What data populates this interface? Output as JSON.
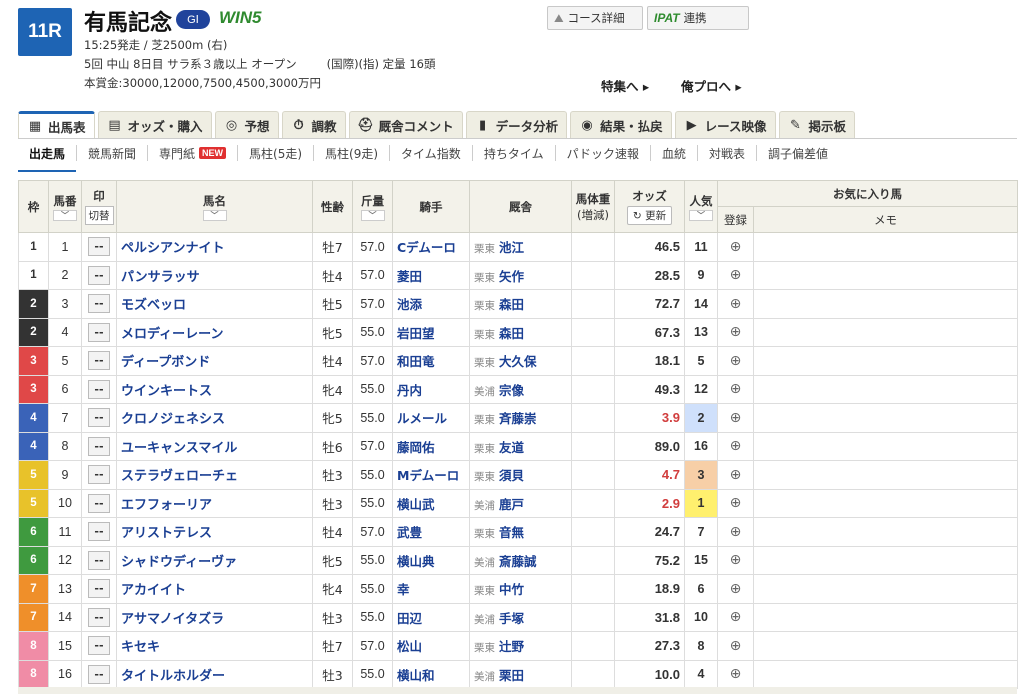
{
  "race": {
    "number": "11R",
    "title": "有馬記念",
    "grade": "GⅠ",
    "win5": "WIN5",
    "time_course": "15:25発走 / 芝2500m (右)",
    "meeting": "5回 中山 8日目 サラ系３歳以上 オープン",
    "conditions": "(国際)(指) 定量 16頭",
    "prize": "本賞金:30000,12000,7500,4500,3000万円"
  },
  "buttons": {
    "course": "コース詳細",
    "ipat_logo": "IPAT",
    "ipat": "連携"
  },
  "links": {
    "special": "特集へ ▸",
    "pro": "俺プロへ ▸"
  },
  "tabs": [
    {
      "label": "出馬表",
      "icon": "table-icon",
      "glyph": "▦"
    },
    {
      "label": "オッズ・購入",
      "icon": "calculator-icon",
      "glyph": "▤"
    },
    {
      "label": "予想",
      "icon": "target-icon",
      "glyph": "◎"
    },
    {
      "label": "調教",
      "icon": "stopwatch-icon",
      "glyph": "⏱"
    },
    {
      "label": "厩舎コメント",
      "icon": "helmet-icon",
      "glyph": "⛑"
    },
    {
      "label": "データ分析",
      "icon": "bar-chart-icon",
      "glyph": "▮"
    },
    {
      "label": "結果・払戻",
      "icon": "coins-icon",
      "glyph": "◉"
    },
    {
      "label": "レース映像",
      "icon": "video-icon",
      "glyph": "▶"
    },
    {
      "label": "掲示板",
      "icon": "chat-icon",
      "glyph": "✎"
    }
  ],
  "subtabs": {
    "t0": "出走馬",
    "t1": "競馬新聞",
    "t2": "専門紙",
    "new": "NEW",
    "t3": "馬柱(5走)",
    "t4": "馬柱(9走)",
    "t5": "タイム指数",
    "t6": "持ちタイム",
    "t7": "パドック速報",
    "t8": "血統",
    "t9": "対戦表",
    "t10": "調子偏差値"
  },
  "headers": {
    "waku": "枠",
    "umaban": "馬番",
    "mark": "印",
    "kirikae": "切替",
    "name": "馬名",
    "sexage": "性齢",
    "weight": "斤量",
    "jockey": "騎手",
    "stable": "厩舎",
    "bodyweight": "馬体重",
    "bodyweight2": "(増減)",
    "odds": "オッズ",
    "refresh": "更新",
    "pop": "人気",
    "fav": "お気に入り馬",
    "register": "登録",
    "memo": "メモ",
    "sort": "﹀"
  },
  "horses": [
    {
      "waku": "1",
      "num": "1",
      "mark": "--",
      "name": "ペルシアンナイト",
      "sexage": "牡7",
      "weight": "57.0",
      "jockey": "Cデムーロ",
      "stable": "栗東",
      "trainer": "池江",
      "odds": "46.5",
      "pop": "11"
    },
    {
      "waku": "1",
      "num": "2",
      "mark": "--",
      "name": "パンサラッサ",
      "sexage": "牡4",
      "weight": "57.0",
      "jockey": "菱田",
      "stable": "栗東",
      "trainer": "矢作",
      "odds": "28.5",
      "pop": "9"
    },
    {
      "waku": "2",
      "num": "3",
      "mark": "--",
      "name": "モズベッロ",
      "sexage": "牡5",
      "weight": "57.0",
      "jockey": "池添",
      "stable": "栗東",
      "trainer": "森田",
      "odds": "72.7",
      "pop": "14"
    },
    {
      "waku": "2",
      "num": "4",
      "mark": "--",
      "name": "メロディーレーン",
      "sexage": "牝5",
      "weight": "55.0",
      "jockey": "岩田望",
      "stable": "栗東",
      "trainer": "森田",
      "odds": "67.3",
      "pop": "13"
    },
    {
      "waku": "3",
      "num": "5",
      "mark": "--",
      "name": "ディープボンド",
      "sexage": "牡4",
      "weight": "57.0",
      "jockey": "和田竜",
      "stable": "栗東",
      "trainer": "大久保",
      "odds": "18.1",
      "pop": "5"
    },
    {
      "waku": "3",
      "num": "6",
      "mark": "--",
      "name": "ウインキートス",
      "sexage": "牝4",
      "weight": "55.0",
      "jockey": "丹内",
      "stable": "美浦",
      "trainer": "宗像",
      "odds": "49.3",
      "pop": "12"
    },
    {
      "waku": "4",
      "num": "7",
      "mark": "--",
      "name": "クロノジェネシス",
      "sexage": "牝5",
      "weight": "55.0",
      "jockey": "ルメール",
      "stable": "栗東",
      "trainer": "斉藤崇",
      "odds": "3.9",
      "pop": "2"
    },
    {
      "waku": "4",
      "num": "8",
      "mark": "--",
      "name": "ユーキャンスマイル",
      "sexage": "牡6",
      "weight": "57.0",
      "jockey": "藤岡佑",
      "stable": "栗東",
      "trainer": "友道",
      "odds": "89.0",
      "pop": "16"
    },
    {
      "waku": "5",
      "num": "9",
      "mark": "--",
      "name": "ステラヴェローチェ",
      "sexage": "牡3",
      "weight": "55.0",
      "jockey": "Mデムーロ",
      "stable": "栗東",
      "trainer": "須貝",
      "odds": "4.7",
      "pop": "3"
    },
    {
      "waku": "5",
      "num": "10",
      "mark": "--",
      "name": "エフフォーリア",
      "sexage": "牡3",
      "weight": "55.0",
      "jockey": "横山武",
      "stable": "美浦",
      "trainer": "鹿戸",
      "odds": "2.9",
      "pop": "1"
    },
    {
      "waku": "6",
      "num": "11",
      "mark": "--",
      "name": "アリストテレス",
      "sexage": "牡4",
      "weight": "57.0",
      "jockey": "武豊",
      "stable": "栗東",
      "trainer": "音無",
      "odds": "24.7",
      "pop": "7"
    },
    {
      "waku": "6",
      "num": "12",
      "mark": "--",
      "name": "シャドウディーヴァ",
      "sexage": "牝5",
      "weight": "55.0",
      "jockey": "横山典",
      "stable": "美浦",
      "trainer": "斎藤誠",
      "odds": "75.2",
      "pop": "15"
    },
    {
      "waku": "7",
      "num": "13",
      "mark": "--",
      "name": "アカイイト",
      "sexage": "牝4",
      "weight": "55.0",
      "jockey": "幸",
      "stable": "栗東",
      "trainer": "中竹",
      "odds": "18.9",
      "pop": "6"
    },
    {
      "waku": "7",
      "num": "14",
      "mark": "--",
      "name": "アサマノイタズラ",
      "sexage": "牡3",
      "weight": "55.0",
      "jockey": "田辺",
      "stable": "美浦",
      "trainer": "手塚",
      "odds": "31.8",
      "pop": "10"
    },
    {
      "waku": "8",
      "num": "15",
      "mark": "--",
      "name": "キセキ",
      "sexage": "牡7",
      "weight": "57.0",
      "jockey": "松山",
      "stable": "栗東",
      "trainer": "辻野",
      "odds": "27.3",
      "pop": "8"
    },
    {
      "waku": "8",
      "num": "16",
      "mark": "--",
      "name": "タイトルホルダー",
      "sexage": "牡3",
      "weight": "55.0",
      "jockey": "横山和",
      "stable": "美浦",
      "trainer": "栗田",
      "odds": "10.0",
      "pop": "4"
    }
  ],
  "colors": {
    "waku": {
      "1": "#ffffff",
      "2": "#333333",
      "3": "#e04848",
      "4": "#3a63b8",
      "5": "#e8c22a",
      "6": "#3f9a3f",
      "7": "#ef8f2a",
      "8": "#f08ca6"
    },
    "pop_bg": {
      "1": "#fff06e",
      "2": "#cfe0fb",
      "3": "#f7cfa7"
    },
    "accent": "#1e64b4"
  }
}
